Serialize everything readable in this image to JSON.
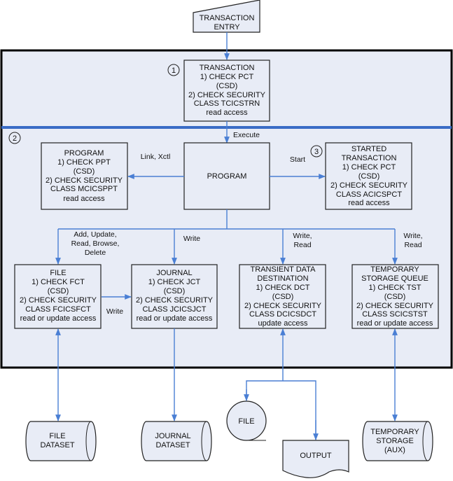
{
  "colors": {
    "frame_fill": "#e8ecf6",
    "connector": "#4a7fd4",
    "divider": "#3a6cc6",
    "frame_border": "#000000"
  },
  "entry": {
    "lines": [
      "TRANSACTION",
      "ENTRY"
    ]
  },
  "transaction": {
    "marker": "1",
    "lines": [
      "TRANSACTION",
      "1) CHECK PCT",
      "(CSD)",
      "2) CHECK SECURITY",
      "CLASS TCICSTRN",
      "read access"
    ]
  },
  "region2_marker": "2",
  "execute_label": "Execute",
  "program_link": {
    "lines": [
      "PROGRAM",
      "1) CHECK PPT",
      "(CSD)",
      "2) CHECK SECURITY",
      "CLASS MCICSPPT",
      "read access"
    ]
  },
  "program": {
    "label": "PROGRAM"
  },
  "started": {
    "marker": "3",
    "lines": [
      "STARTED",
      "TRANSACTION",
      "1) CHECK PCT",
      "(CSD)",
      "2) CHECK SECURITY",
      "CLASS ACICSPCT",
      "read access"
    ]
  },
  "link_label": "Link, Xctl",
  "start_label": "Start",
  "file_ops_label": [
    "Add, Update,",
    "Read, Browse,",
    "Delete"
  ],
  "journal_op_label": "Write",
  "td_ops_label": [
    "Write,",
    "Read"
  ],
  "ts_ops_label": [
    "Write,",
    "Read"
  ],
  "file_to_journal_label": "Write",
  "file": {
    "lines": [
      "FILE",
      "1) CHECK FCT",
      "(CSD)",
      "2) CHECK SECURITY",
      "CLASS FCICSFCT",
      "read or update access"
    ]
  },
  "journal": {
    "lines": [
      "JOURNAL",
      "1) CHECK JCT",
      "(CSD)",
      "2) CHECK SECURITY",
      "CLASS JCICSJCT",
      "read or update access"
    ]
  },
  "tdd": {
    "lines": [
      "TRANSIENT DATA",
      "DESTINATION",
      "1) CHECK DCT",
      "(CSD)",
      "2) CHECK SECURITY",
      "CLASS DCICSDCT",
      "update access"
    ]
  },
  "tsq": {
    "lines": [
      "TEMPORARY",
      "STORAGE QUEUE",
      "1) CHECK TST",
      "(CSD)",
      "2) CHECK SECURITY",
      "CLASS SCICSTST",
      "read or update access"
    ]
  },
  "file_dataset": {
    "lines": [
      "FILE",
      "DATASET"
    ]
  },
  "journal_dataset": {
    "lines": [
      "JOURNAL",
      "DATASET"
    ]
  },
  "td_file": {
    "label": "FILE"
  },
  "td_output": {
    "label": "OUTPUT"
  },
  "temp_storage": {
    "lines": [
      "TEMPORARY",
      "STORAGE",
      "(AUX)"
    ]
  }
}
